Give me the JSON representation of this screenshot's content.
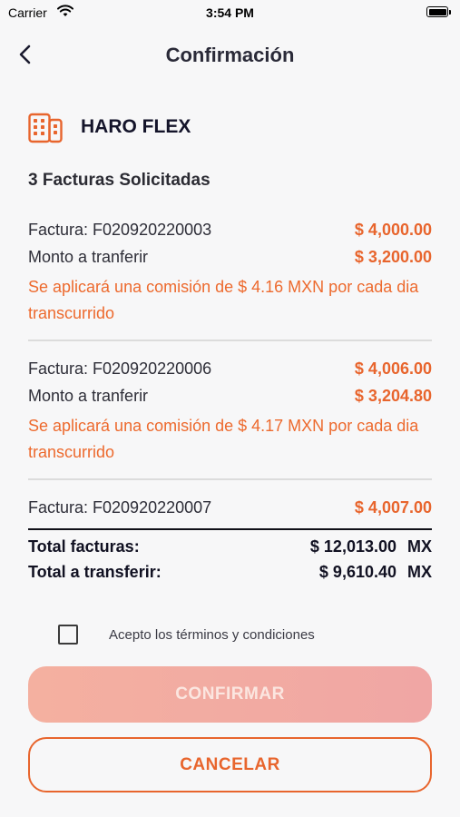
{
  "status_bar": {
    "carrier": "Carrier",
    "time": "3:54 PM",
    "battery_level": 1.0
  },
  "nav": {
    "title": "Confirmación"
  },
  "company": {
    "name": "HARO FLEX",
    "icon": "building-icon"
  },
  "summary": {
    "count_label": "3 Facturas Solicitadas"
  },
  "invoices": [
    {
      "factura_label": "Factura: F020920220003",
      "factura_amount": "$ 4,000.00",
      "monto_label": "Monto a tranferir",
      "monto_amount": "$ 3,200.00",
      "notice": "Se aplicará una comisión de $ 4.16 MXN por cada dia transcurrido"
    },
    {
      "factura_label": "Factura: F020920220006",
      "factura_amount": "$ 4,006.00",
      "monto_label": "Monto a tranferir",
      "monto_amount": "$ 3,204.80",
      "notice": "Se aplicará una comisión de $ 4.17 MXN por cada dia transcurrido"
    },
    {
      "factura_label": "Factura: F020920220007",
      "factura_amount": "$ 4,007.00"
    }
  ],
  "totals": {
    "facturas_label": "Total facturas:",
    "facturas_value": "$ 12,013.00",
    "transferir_label": "Total a transferir:",
    "transferir_value": "$ 9,610.40",
    "currency": "MX"
  },
  "terms": {
    "label": "Acepto los términos y condiciones",
    "checked": false
  },
  "buttons": {
    "confirm": "CONFIRMAR",
    "cancel": "CANCELAR"
  },
  "colors": {
    "accent": "#e8652d",
    "confirm_disabled": "#f2aca2",
    "background": "#f7f7f8"
  }
}
